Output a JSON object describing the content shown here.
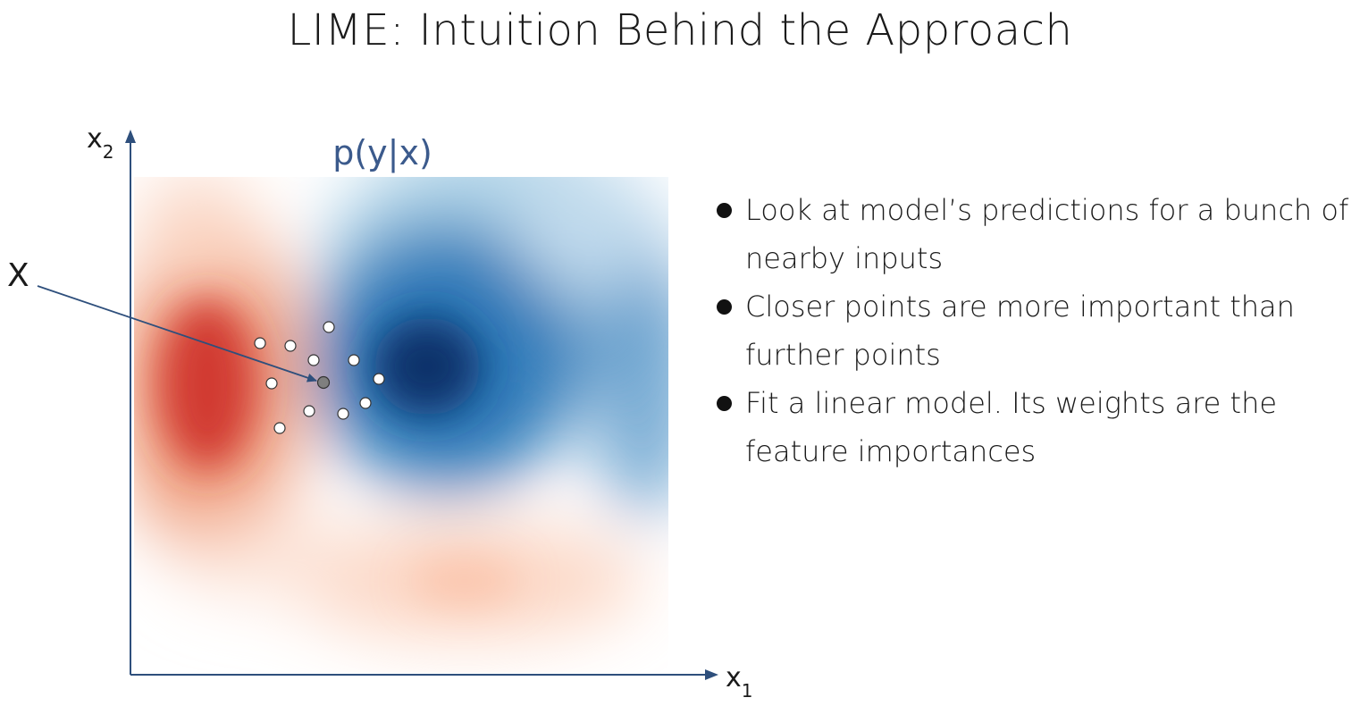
{
  "title": "LIME: Intuition Behind the Approach",
  "diagram": {
    "heatmap_label": "p(y|x)",
    "axis_x_label": "x",
    "axis_x_subscript": "1",
    "axis_y_label": "x",
    "axis_y_subscript": "2",
    "instance_label": "X",
    "colors": {
      "axis": "#2e4f7c",
      "negative": "#d03b32",
      "positive": "#08447f",
      "query_point": "#7f7f7f"
    }
  },
  "bullets": [
    "Look at model’s predictions for a bunch of nearby inputs",
    "Closer points are more important than further points",
    "Fit a linear model. Its weights are the feature importances"
  ]
}
